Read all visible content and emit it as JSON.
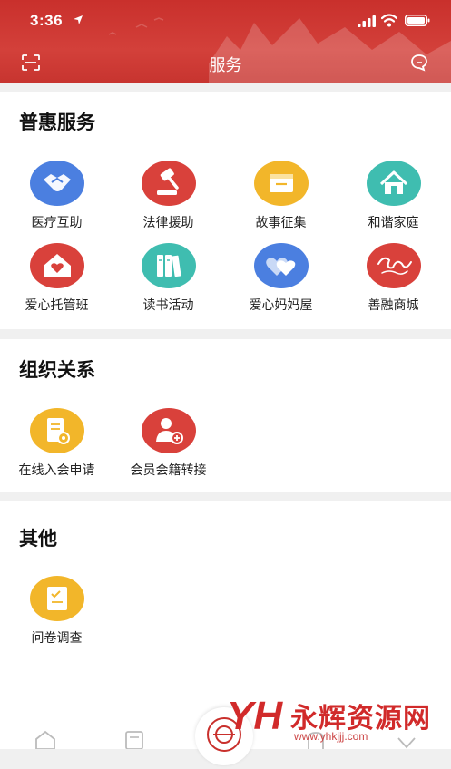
{
  "status": {
    "time": "3:36"
  },
  "nav": {
    "title": "服务",
    "left_icon": "scan-icon",
    "right_icon": "message-icon"
  },
  "colors": {
    "header_red": "#c9302c",
    "icon_blue": "#4b7fe0",
    "icon_red": "#d9413b",
    "icon_yellow": "#f2b62a",
    "icon_teal": "#3fbdb0"
  },
  "sections": {
    "puhui": {
      "title": "普惠服务",
      "items": [
        {
          "label": "医疗互助",
          "icon": "handshake-icon"
        },
        {
          "label": "法律援助",
          "icon": "gavel-icon"
        },
        {
          "label": "故事征集",
          "icon": "folder-icon"
        },
        {
          "label": "和谐家庭",
          "icon": "house-icon"
        },
        {
          "label": "爱心托管班",
          "icon": "heart-house-icon"
        },
        {
          "label": "读书活动",
          "icon": "books-icon"
        },
        {
          "label": "爱心妈妈屋",
          "icon": "hearts-icon"
        },
        {
          "label": "善融商城",
          "icon": "shanrong-logo-icon"
        }
      ]
    },
    "org": {
      "title": "组织关系",
      "items": [
        {
          "label": "在线入会申请",
          "icon": "application-form-icon"
        },
        {
          "label": "会员会籍转接",
          "icon": "add-member-icon"
        }
      ]
    },
    "other": {
      "title": "其他",
      "items": [
        {
          "label": "问卷调查",
          "icon": "survey-icon"
        }
      ]
    }
  },
  "watermark": {
    "logo": "YH",
    "name": "永辉资源网",
    "url": "www.yhkjjj.com"
  }
}
